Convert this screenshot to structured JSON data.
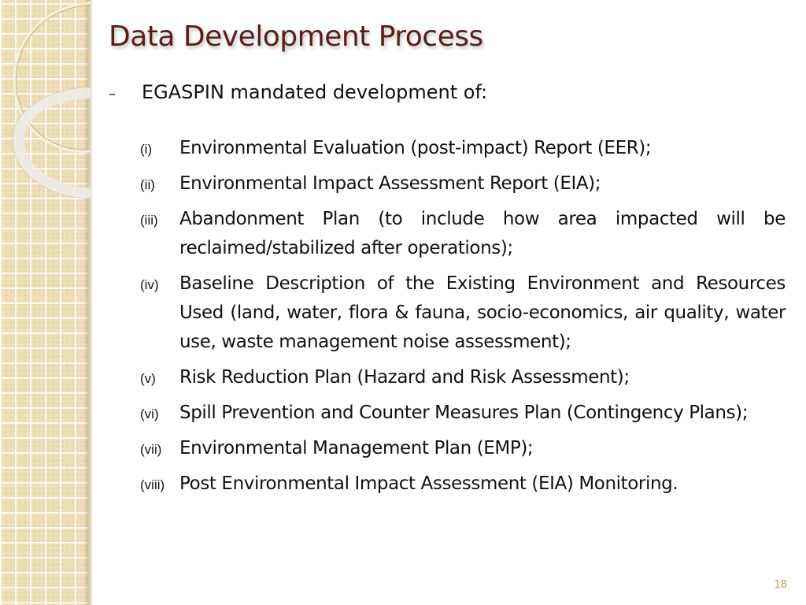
{
  "slide": {
    "title": "Data Development Process",
    "intro": {
      "bullet": "–",
      "text": "EGASPIN mandated development of:"
    },
    "items": [
      {
        "num": "(i)",
        "text": "Environmental Evaluation (post-impact) Report (EER);"
      },
      {
        "num": "(ii)",
        "text": "Environmental Impact Assessment Report (EIA);"
      },
      {
        "num": "(iii)",
        "text": "Abandonment Plan (to include how area impacted will be reclaimed/stabilized after operations);"
      },
      {
        "num": "(iv)",
        "text": "Baseline Description of the Existing Environment and Resources Used (land, water, flora & fauna, socio-economics, air quality, water use, waste management noise assessment);"
      },
      {
        "num": "(v)",
        "text": "Risk Reduction Plan (Hazard and Risk Assessment);"
      },
      {
        "num": "(vi)",
        "text": "Spill Prevention and Counter Measures Plan (Contingency Plans);"
      },
      {
        "num": "(vii)",
        "text": "Environmental Management Plan (EMP);"
      },
      {
        "num": "(viii)",
        "text": "Post Environmental Impact Assessment (EIA) Monitoring."
      }
    ],
    "page_number": "18"
  },
  "colors": {
    "title": "#5a1e14",
    "body_text": "#111111",
    "sidebar": "#efdfb8",
    "page_number": "#b89a60"
  }
}
